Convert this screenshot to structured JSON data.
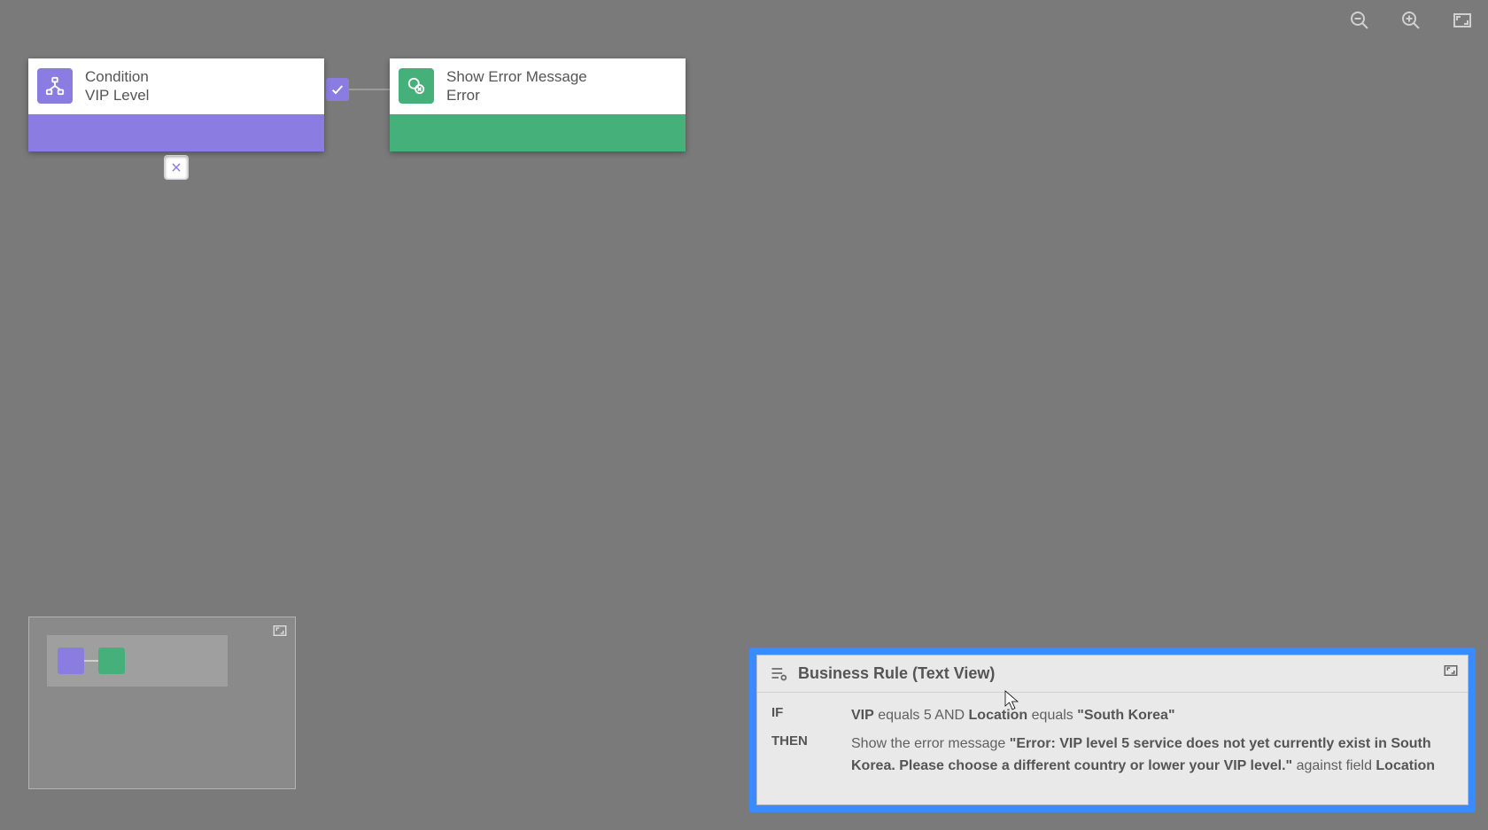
{
  "nodes": {
    "condition": {
      "title": "Condition",
      "subtitle": "VIP Level"
    },
    "action": {
      "title": "Show Error Message",
      "subtitle": "Error"
    }
  },
  "textview": {
    "title": "Business Rule (Text View)",
    "if_kw": "IF",
    "then_kw": "THEN",
    "if_line": {
      "field1": "VIP",
      "seg1": " equals 5 AND ",
      "field2": "Location",
      "seg2": " equals ",
      "value2": "\"South Korea\""
    },
    "then_line": {
      "pre": "Show the error message ",
      "msg": "\"Error: VIP level 5 service does not yet currently exist in South Korea. Please choose a different country or lower your VIP level.\"",
      "post": " against field ",
      "field": "Location"
    }
  }
}
